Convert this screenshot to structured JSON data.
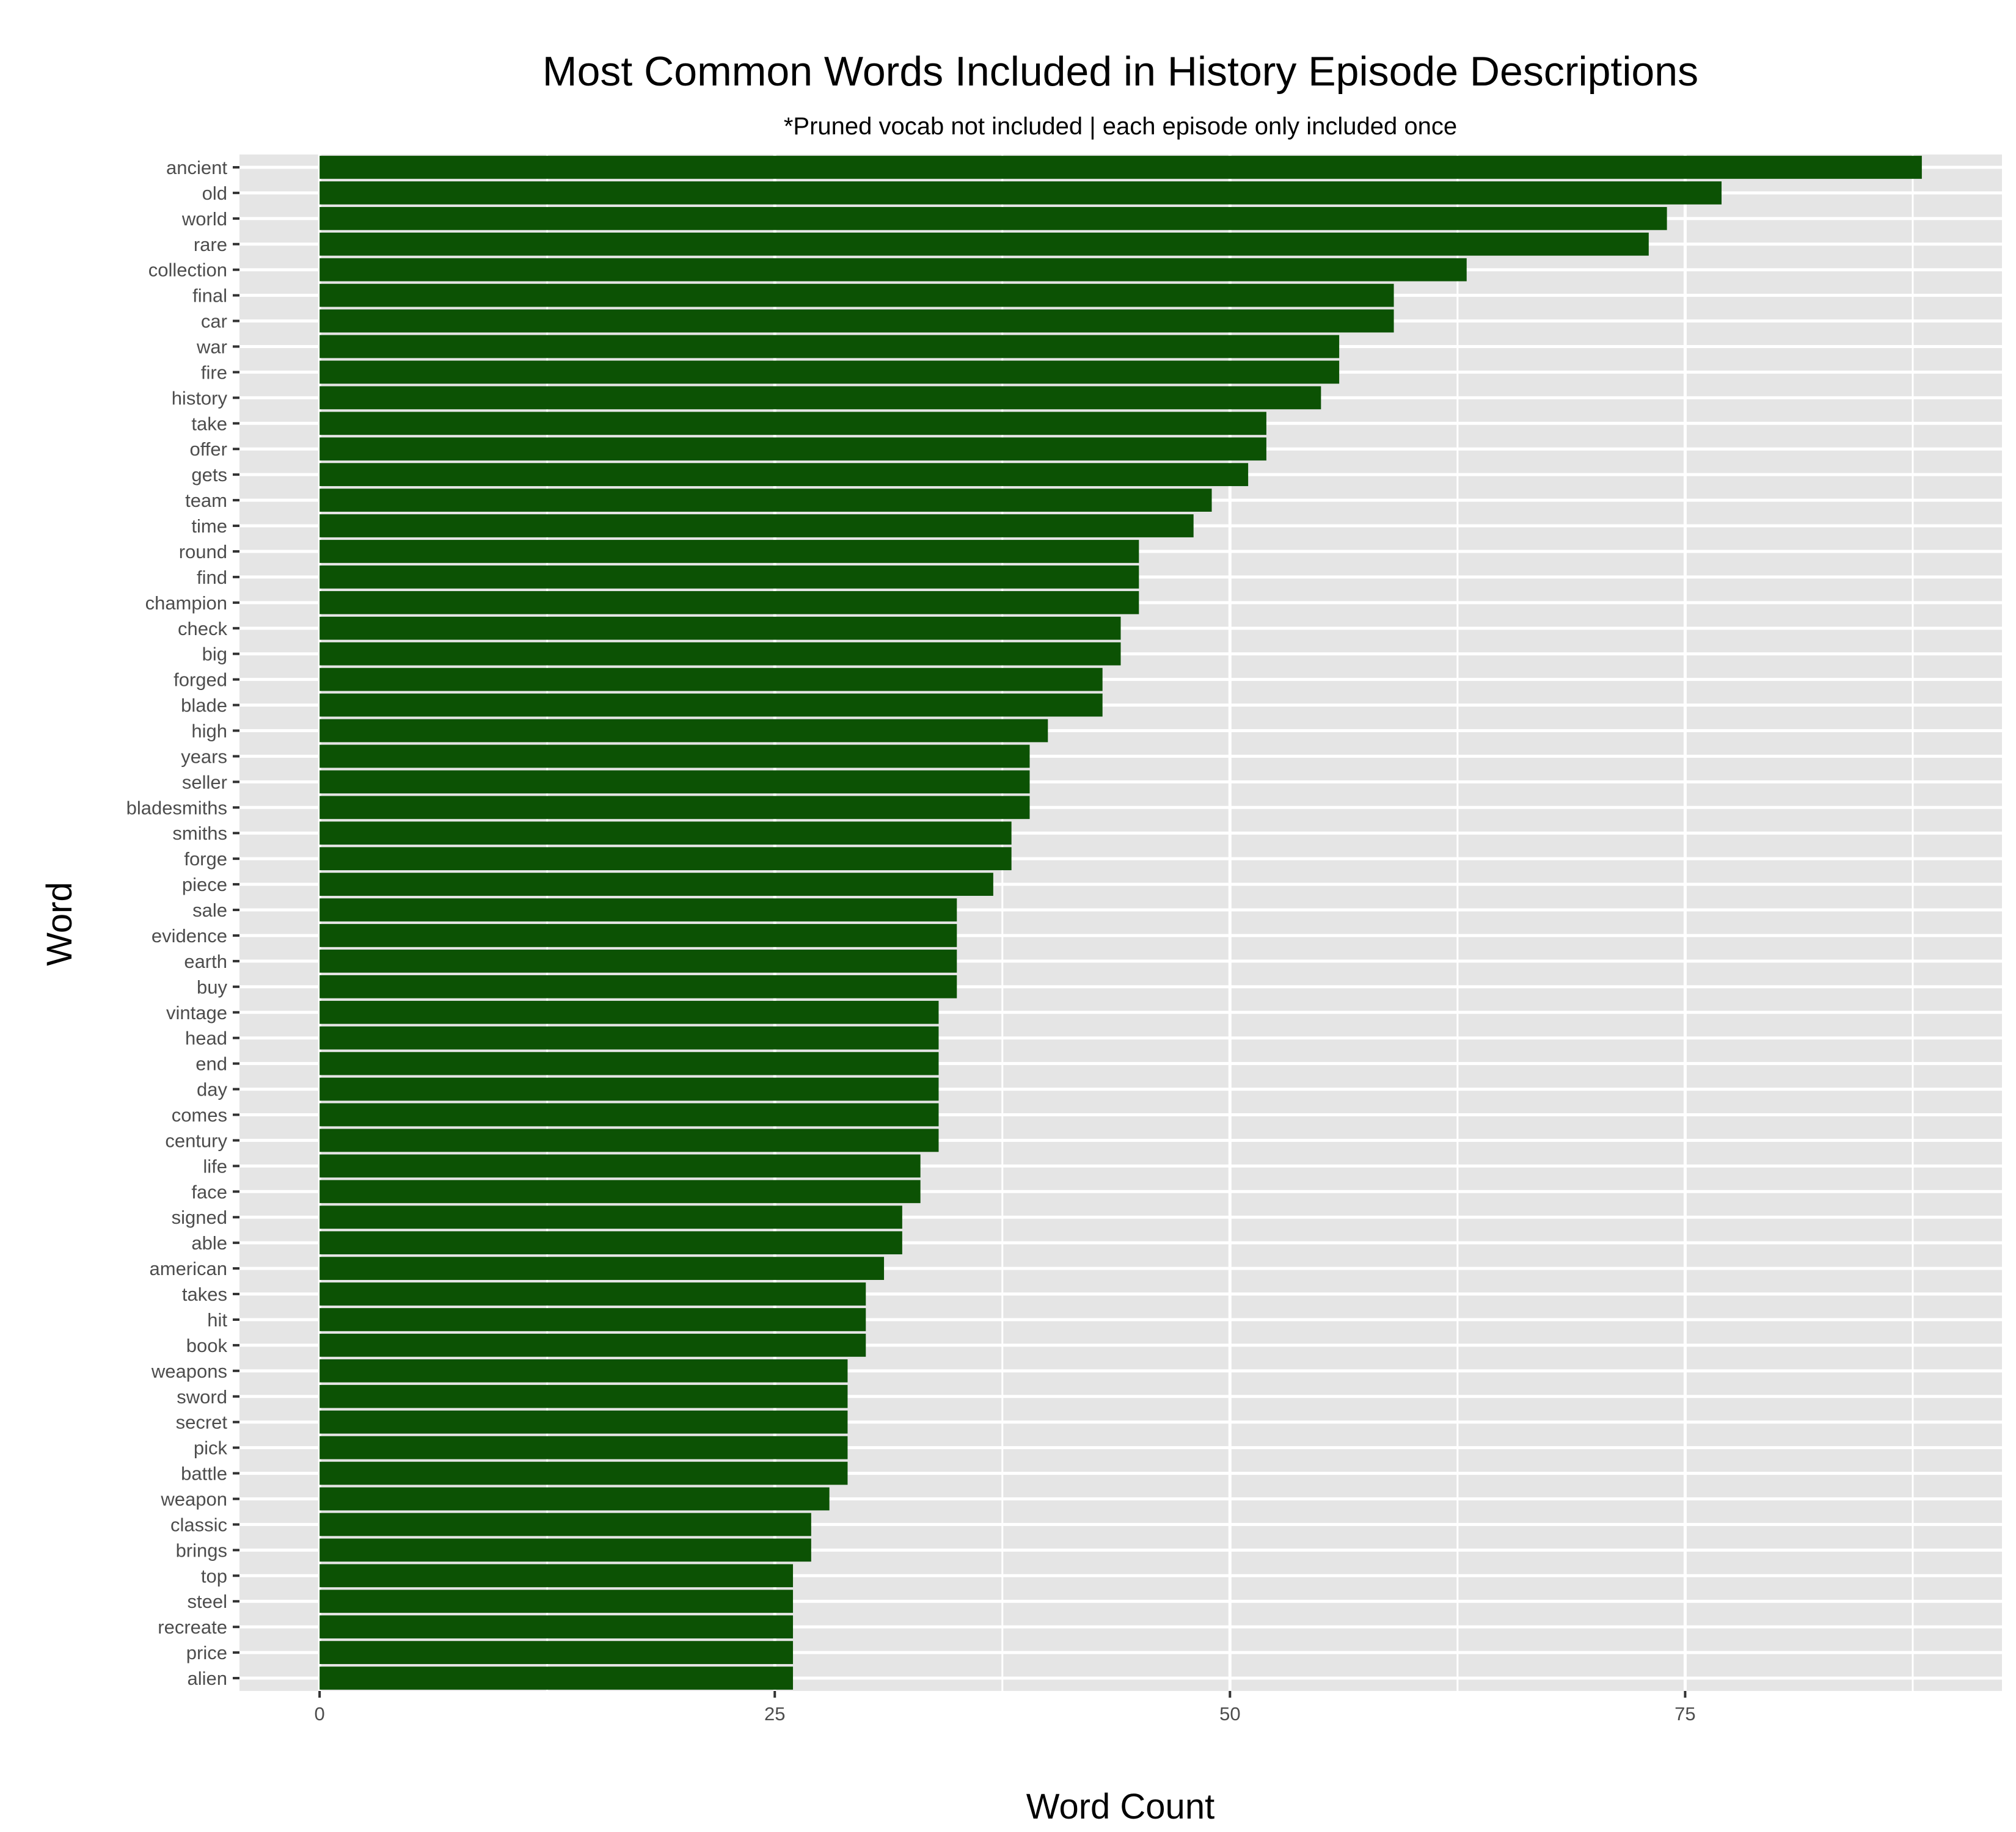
{
  "chart_data": {
    "type": "bar",
    "orientation": "horizontal",
    "title": "Most Common Words Included in History Episode Descriptions",
    "subtitle": "*Pruned vocab not included | each episode only included once",
    "xlabel": "Word Count",
    "ylabel": "Word",
    "xlim": [
      -4.4,
      92.4
    ],
    "x_ticks": [
      0,
      25,
      50,
      75
    ],
    "x_tick_labels": [
      "0",
      "25",
      "50",
      "75"
    ],
    "x_minor_ticks": [
      12.5,
      37.5,
      62.5,
      87.5
    ],
    "grid": true,
    "legend": "none",
    "colors": {
      "bar": "#0c5204",
      "panel_background": "#e5e5e5",
      "grid": "#ffffff",
      "tick": "#333333"
    },
    "categories": [
      "ancient",
      "old",
      "world",
      "rare",
      "collection",
      "final",
      "car",
      "war",
      "fire",
      "history",
      "take",
      "offer",
      "gets",
      "team",
      "time",
      "round",
      "find",
      "champion",
      "check",
      "big",
      "forged",
      "blade",
      "high",
      "years",
      "seller",
      "bladesmiths",
      "smiths",
      "forge",
      "piece",
      "sale",
      "evidence",
      "earth",
      "buy",
      "vintage",
      "head",
      "end",
      "day",
      "comes",
      "century",
      "life",
      "face",
      "signed",
      "able",
      "american",
      "takes",
      "hit",
      "book",
      "weapons",
      "sword",
      "secret",
      "pick",
      "battle",
      "weapon",
      "classic",
      "brings",
      "top",
      "steel",
      "recreate",
      "price",
      "alien"
    ],
    "values": [
      88,
      77,
      74,
      73,
      63,
      59,
      59,
      56,
      56,
      55,
      52,
      52,
      51,
      49,
      48,
      45,
      45,
      45,
      44,
      44,
      43,
      43,
      40,
      39,
      39,
      39,
      38,
      38,
      37,
      35,
      35,
      35,
      35,
      34,
      34,
      34,
      34,
      34,
      34,
      33,
      33,
      32,
      32,
      31,
      30,
      30,
      30,
      29,
      29,
      29,
      29,
      29,
      28,
      27,
      27,
      26,
      26,
      26,
      26,
      26
    ]
  }
}
